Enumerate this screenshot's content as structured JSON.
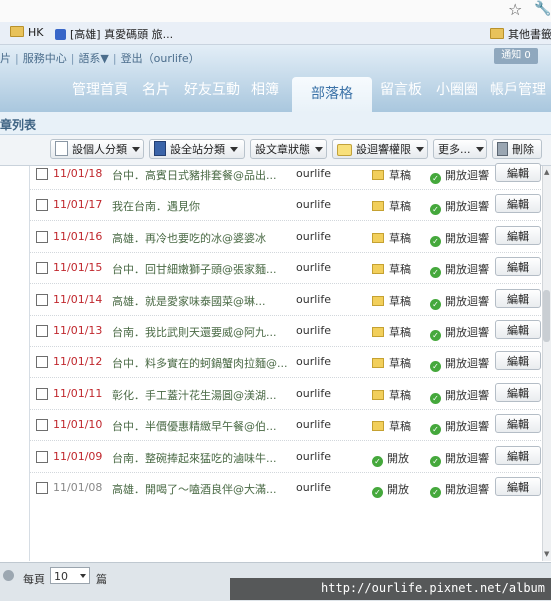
{
  "browser": {
    "bookmarks": [
      {
        "label": "HK"
      },
      {
        "label": "[高雄] 真愛碼頭 旅..."
      }
    ],
    "bookmarks_right": "其他書籤"
  },
  "header": {
    "top_links": [
      "片",
      "服務中心",
      "語系▼",
      "登出（ourlife）"
    ],
    "notify": "通知 0",
    "nav": [
      "管理首頁",
      "名片",
      "好友互動",
      "相簿",
      "部落格",
      "留言板",
      "小圈圈",
      "帳戶管理"
    ],
    "active_nav": "部落格"
  },
  "subheader": {
    "title": "章列表"
  },
  "toolbar": {
    "personal_category": "設個人分類",
    "site_category": "設全站分類",
    "article_status": "設文章狀態",
    "set_permission": "設迴響權限",
    "more": "更多...",
    "delete": "刪除"
  },
  "articles": [
    {
      "date": "11/01/18",
      "title": "台中．高賓日式豬排套餐@品出...",
      "author": "ourlife",
      "status": "草稿",
      "permission": "開放迴響",
      "edit": "編輯",
      "gray": false
    },
    {
      "date": "11/01/17",
      "title": "我在台南．遇見你",
      "author": "ourlife",
      "status": "草稿",
      "permission": "開放迴響",
      "edit": "編輯",
      "gray": false
    },
    {
      "date": "11/01/16",
      "title": "高雄．再冷也要吃的冰@婆婆冰",
      "author": "ourlife",
      "status": "草稿",
      "permission": "開放迴響",
      "edit": "編輯",
      "gray": false
    },
    {
      "date": "11/01/15",
      "title": "台中．回甘細嫩獅子頭@張家麵...",
      "author": "ourlife",
      "status": "草稿",
      "permission": "開放迴響",
      "edit": "編輯",
      "gray": false
    },
    {
      "date": "11/01/14",
      "title": "高雄．就是愛家味泰國菜@琳...",
      "author": "ourlife",
      "status": "草稿",
      "permission": "開放迴響",
      "edit": "編輯",
      "gray": false
    },
    {
      "date": "11/01/13",
      "title": "台南．我比武則天還要威@阿九...",
      "author": "ourlife",
      "status": "草稿",
      "permission": "開放迴響",
      "edit": "編輯",
      "gray": false
    },
    {
      "date": "11/01/12",
      "title": "台中．料多實在的蚵鍋蟹肉拉麵@...",
      "author": "ourlife",
      "status": "草稿",
      "permission": "開放迴響",
      "edit": "編輯",
      "gray": false
    },
    {
      "date": "11/01/11",
      "title": "彰化．手工蓋汁花生湯圓@渼湖...",
      "author": "ourlife",
      "status": "草稿",
      "permission": "開放迴響",
      "edit": "編輯",
      "gray": false
    },
    {
      "date": "11/01/10",
      "title": "台中．半價優惠精緻早午餐@伯...",
      "author": "ourlife",
      "status": "草稿",
      "permission": "開放迴響",
      "edit": "編輯",
      "gray": false
    },
    {
      "date": "11/01/09",
      "title": "台南．整碗捧起來猛吃的滷味牛...",
      "author": "ourlife",
      "status": "開放",
      "permission": "開放迴響",
      "edit": "編輯",
      "gray": false
    },
    {
      "date": "11/01/08",
      "title": "高雄．開喝了～嗑酒良伴@大滿...",
      "author": "ourlife",
      "status": "開放",
      "permission": "開放迴響",
      "edit": "編輯",
      "gray": true
    }
  ],
  "footer": {
    "per_page_label": "每頁",
    "per_page_value": "10",
    "unit": "篇"
  },
  "watermark": "http://ourlife.pixnet.net/album"
}
